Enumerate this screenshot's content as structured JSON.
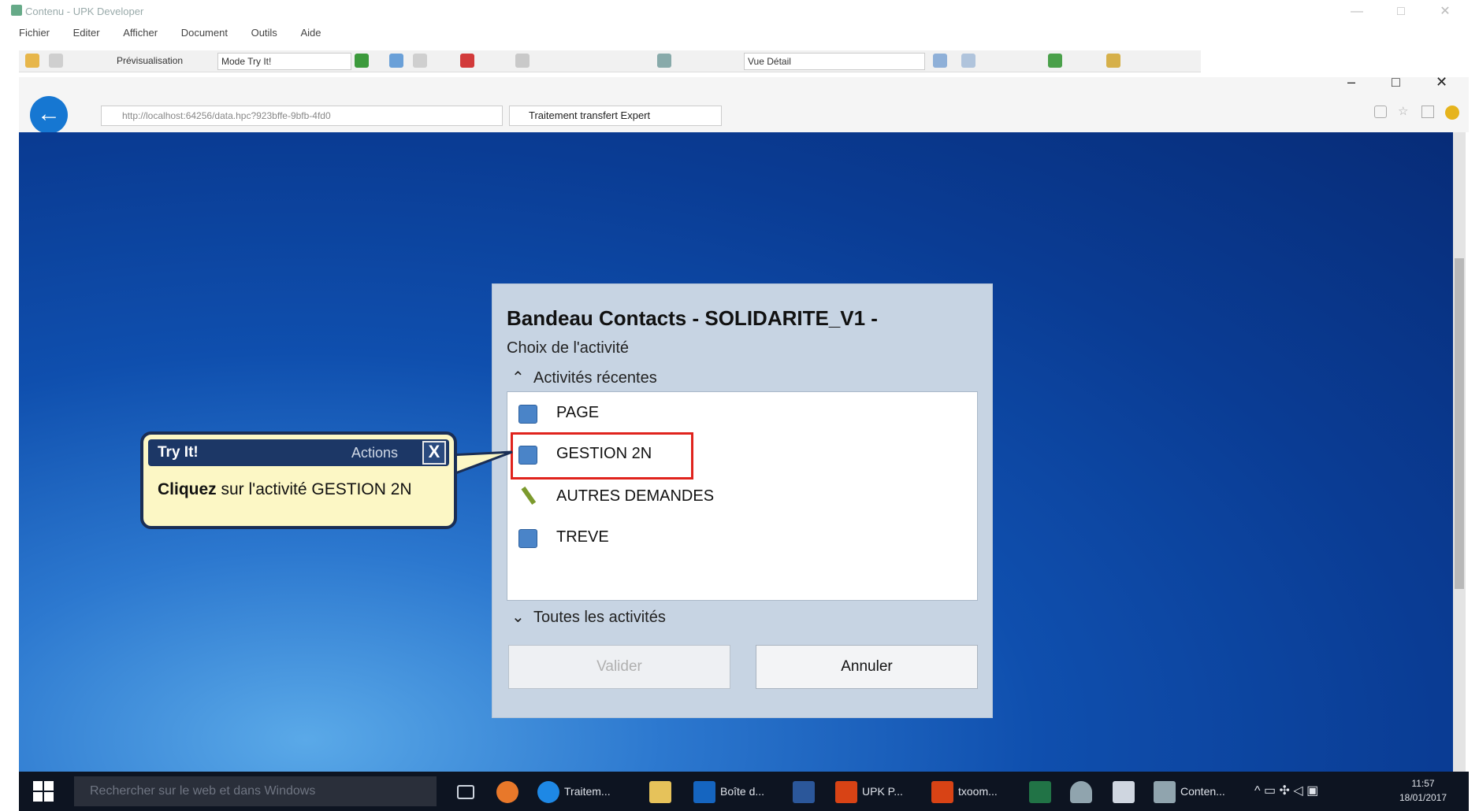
{
  "window": {
    "title": "Contenu - UPK Developer"
  },
  "menubar": {
    "items": [
      "Fichier",
      "Editer",
      "Afficher",
      "Document",
      "Outils",
      "Aide"
    ]
  },
  "toolbar": {
    "preview_label": "Prévisualisation",
    "mode_value": "Mode Try It!",
    "view_value": "Vue Détail"
  },
  "browser": {
    "url": "http://localhost:64256/data.hpc?923bffe-9bfb-4fd0",
    "tab_title": "Traitement transfert Expert"
  },
  "dialog": {
    "title": "Bandeau Contacts - SOLIDARITE_V1 -",
    "subtitle": "Choix de l'activité",
    "recent_header": "Activités récentes",
    "activities": [
      {
        "label": "PAGE",
        "icon": "screen-icon"
      },
      {
        "label": "GESTION 2N",
        "icon": "screen-icon"
      },
      {
        "label": "AUTRES DEMANDES",
        "icon": "pencil-icon"
      },
      {
        "label": "TREVE",
        "icon": "screen-icon"
      }
    ],
    "all_header": "Toutes les activités",
    "validate_label": "Valider",
    "cancel_label": "Annuler"
  },
  "tryit": {
    "title": "Try It!",
    "actions_label": "Actions",
    "close_symbol": "X",
    "message_bold": "Cliquez",
    "message_rest": " sur l'activité GESTION 2N"
  },
  "taskbar": {
    "search_placeholder": "Rechercher sur le web et dans Windows",
    "apps": [
      {
        "label": "Traitem...",
        "color": "#1e88e5"
      },
      {
        "label": "Boîte d...",
        "color": "#1565c0"
      },
      {
        "label": "UPK P...",
        "color": "#d84315"
      },
      {
        "label": "txoom...",
        "color": "#d84315"
      },
      {
        "label": "Conten...",
        "color": "#90a4ae"
      }
    ],
    "time": "11:57",
    "date": "18/01/2017"
  }
}
